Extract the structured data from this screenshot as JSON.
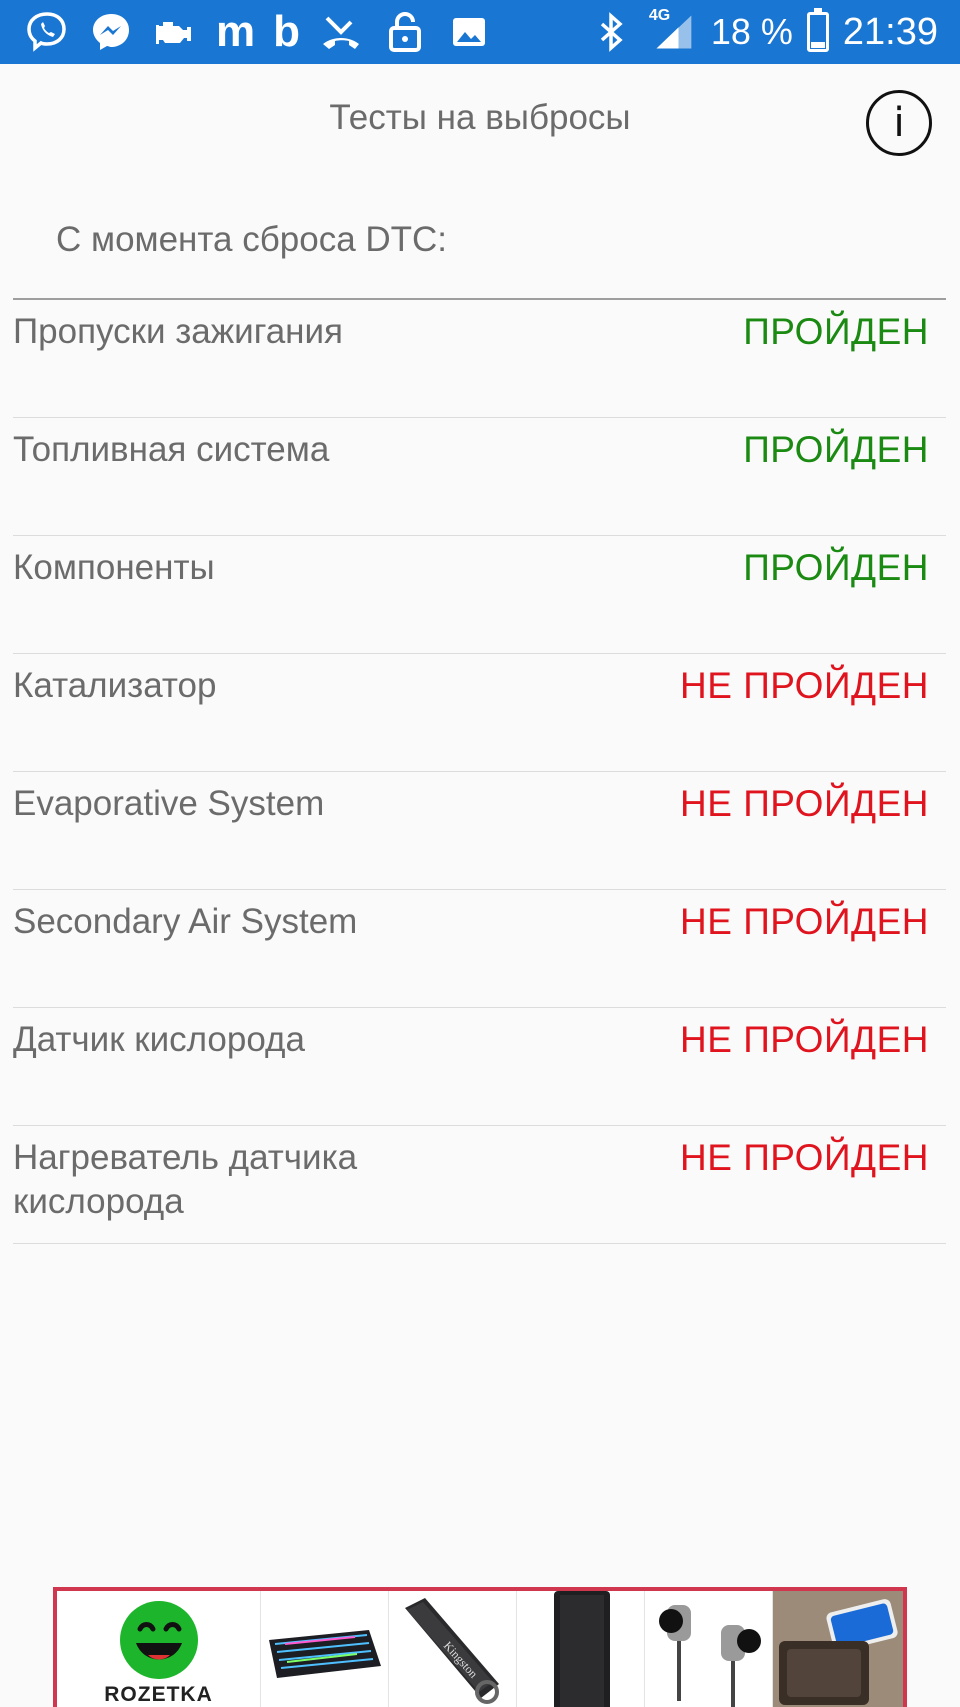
{
  "status_bar": {
    "left_icons": [
      "viber-icon",
      "messenger-icon",
      "car-engine-icon",
      "m-app-icon",
      "b-app-icon",
      "missed-call-icon",
      "lock-open-icon",
      "image-icon"
    ],
    "network": "4G",
    "battery": "18 %",
    "battery_level": 0.18,
    "time": "21:39"
  },
  "header": {
    "title": "Тесты на выбросы",
    "info_icon": "i"
  },
  "section_label": "С момента сброса DTC:",
  "tests": [
    {
      "label": "Пропуски зажигания",
      "status": "ПРОЙДЕН",
      "passed": true
    },
    {
      "label": "Топливная система",
      "status": "ПРОЙДЕН",
      "passed": true
    },
    {
      "label": "Компоненты",
      "status": "ПРОЙДЕН",
      "passed": true
    },
    {
      "label": "Катализатор",
      "status": "НЕ ПРОЙДЕН",
      "passed": false
    },
    {
      "label": "Evaporative System",
      "status": "НЕ ПРОЙДЕН",
      "passed": false
    },
    {
      "label": "Secondary Air System",
      "status": "НЕ ПРОЙДЕН",
      "passed": false
    },
    {
      "label": "Датчик кислорода",
      "status": "НЕ ПРОЙДЕН",
      "passed": false
    },
    {
      "label": "Нагреватель датчика кислорода",
      "status": "НЕ ПРОЙДЕН",
      "passed": false
    }
  ],
  "colors": {
    "status_bar": "#1976d2",
    "passed": "#1b8a12",
    "failed": "#e0141e",
    "ad_border": "#d0364d"
  },
  "ad": {
    "brand": "ROZETKA",
    "items": [
      "rozetka-logo",
      "keyboard-image",
      "usb-flash-drive-image",
      "power-bank-image",
      "earphones-image",
      "phone-charger-image"
    ]
  }
}
